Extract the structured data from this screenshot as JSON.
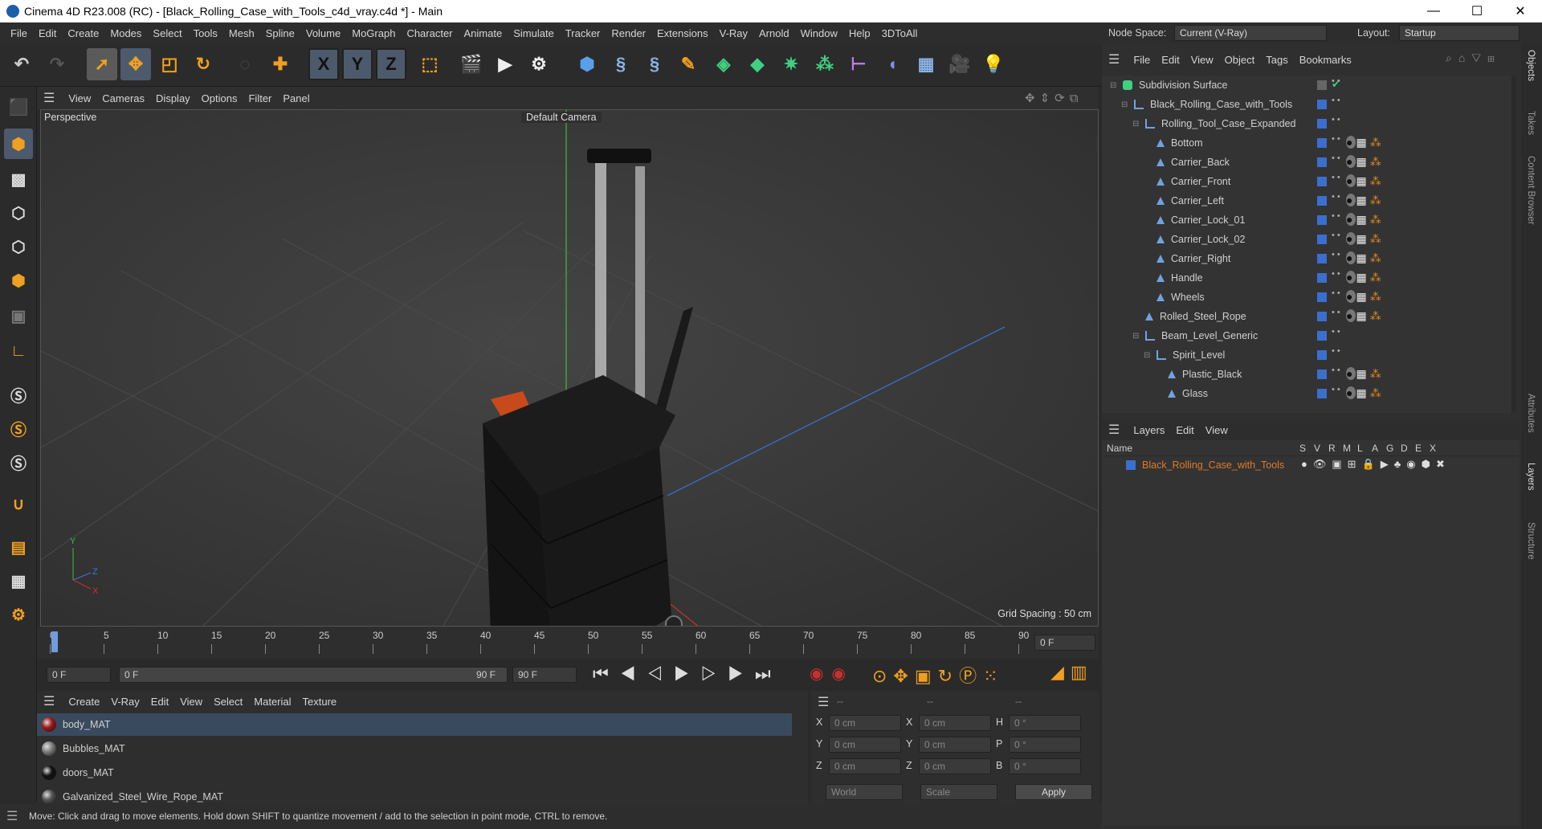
{
  "window": {
    "title": "Cinema 4D R23.008 (RC) - [Black_Rolling_Case_with_Tools_c4d_vray.c4d *] - Main",
    "minimize": "—",
    "maximize": "☐",
    "close": "✕"
  },
  "menu": [
    "File",
    "Edit",
    "Create",
    "Modes",
    "Select",
    "Tools",
    "Mesh",
    "Spline",
    "Volume",
    "MoGraph",
    "Character",
    "Animate",
    "Simulate",
    "Tracker",
    "Render",
    "Extensions",
    "V-Ray",
    "Arnold",
    "Window",
    "Help",
    "3DToAll"
  ],
  "toolbar": {
    "x": "X",
    "y": "Y",
    "z": "Z"
  },
  "viewport": {
    "menu": [
      "View",
      "Cameras",
      "Display",
      "Options",
      "Filter",
      "Panel"
    ],
    "label": "Perspective",
    "camera": "Default Camera",
    "grid_spacing": "Grid Spacing : 50 cm"
  },
  "timeline": {
    "ticks": [
      "0",
      "5",
      "10",
      "15",
      "20",
      "25",
      "30",
      "35",
      "40",
      "45",
      "50",
      "55",
      "60",
      "65",
      "70",
      "75",
      "80",
      "85",
      "90"
    ],
    "current": "0 F"
  },
  "transport": {
    "start": "0 F",
    "range_start": "0 F",
    "range_end": "90 F",
    "end": "90 F"
  },
  "materials": {
    "menu": [
      "Create",
      "V-Ray",
      "Edit",
      "View",
      "Select",
      "Material",
      "Texture"
    ],
    "items": [
      {
        "name": "body_MAT",
        "color": "#a01818"
      },
      {
        "name": "Bubbles_MAT",
        "color": "#808080"
      },
      {
        "name": "doors_MAT",
        "color": "#111111"
      },
      {
        "name": "Galvanized_Steel_Wire_Rope_MAT",
        "color": "#555555"
      }
    ]
  },
  "coords": {
    "head": [
      "--",
      "--",
      "--"
    ],
    "rows": [
      {
        "a": "X",
        "av": "0 cm",
        "b": "X",
        "bv": "0 cm",
        "c": "H",
        "cv": "0 °"
      },
      {
        "a": "Y",
        "av": "0 cm",
        "b": "Y",
        "bv": "0 cm",
        "c": "P",
        "cv": "0 °"
      },
      {
        "a": "Z",
        "av": "0 cm",
        "b": "Z",
        "bv": "0 cm",
        "c": "B",
        "cv": "0 °"
      }
    ],
    "world": "World",
    "scale": "Scale",
    "apply": "Apply"
  },
  "status": "Move: Click and drag to move elements. Hold down SHIFT to quantize movement / add to the selection in point mode, CTRL to remove.",
  "nodespace": {
    "label": "Node Space:",
    "value": "Current (V-Ray)",
    "layout_label": "Layout:",
    "layout_value": "Startup"
  },
  "objmgr": {
    "menu": [
      "File",
      "Edit",
      "View",
      "Object",
      "Tags",
      "Bookmarks"
    ],
    "objects": [
      {
        "name": "Subdivision Surface",
        "depth": 0,
        "kind": "sds"
      },
      {
        "name": "Black_Rolling_Case_with_Tools",
        "depth": 1,
        "kind": "null"
      },
      {
        "name": "Rolling_Tool_Case_Expanded",
        "depth": 2,
        "kind": "null"
      },
      {
        "name": "Bottom",
        "depth": 3,
        "kind": "poly",
        "tags": true
      },
      {
        "name": "Carrier_Back",
        "depth": 3,
        "kind": "poly",
        "tags": true
      },
      {
        "name": "Carrier_Front",
        "depth": 3,
        "kind": "poly",
        "tags": true
      },
      {
        "name": "Carrier_Left",
        "depth": 3,
        "kind": "poly",
        "tags": true
      },
      {
        "name": "Carrier_Lock_01",
        "depth": 3,
        "kind": "poly",
        "tags": true
      },
      {
        "name": "Carrier_Lock_02",
        "depth": 3,
        "kind": "poly",
        "tags": true
      },
      {
        "name": "Carrier_Right",
        "depth": 3,
        "kind": "poly",
        "tags": true
      },
      {
        "name": "Handle",
        "depth": 3,
        "kind": "poly",
        "tags": true
      },
      {
        "name": "Wheels",
        "depth": 3,
        "kind": "poly",
        "tags": true
      },
      {
        "name": "Rolled_Steel_Rope",
        "depth": 2,
        "kind": "poly",
        "tags": true
      },
      {
        "name": "Beam_Level_Generic",
        "depth": 2,
        "kind": "null"
      },
      {
        "name": "Spirit_Level",
        "depth": 3,
        "kind": "null"
      },
      {
        "name": "Plastic_Black",
        "depth": 4,
        "kind": "poly",
        "tags": true
      },
      {
        "name": "Glass",
        "depth": 4,
        "kind": "poly",
        "tags": true
      }
    ]
  },
  "layers": {
    "menu": [
      "Layers",
      "Edit",
      "View"
    ],
    "name_col": "Name",
    "cols": [
      "S",
      "V",
      "R",
      "M",
      "L",
      "A",
      "G",
      "D",
      "E",
      "X"
    ],
    "layer": "Black_Rolling_Case_with_Tools"
  },
  "side_tabs": [
    "Objects",
    "Takes",
    "Content Browser",
    "Attributes",
    "Layers",
    "Structure"
  ]
}
